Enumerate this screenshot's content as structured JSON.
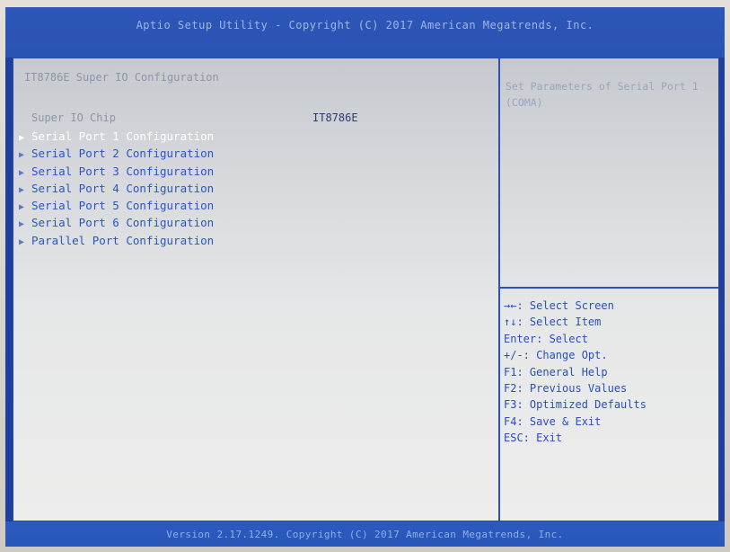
{
  "header": {
    "title": "Aptio Setup Utility - Copyright (C) 2017 American Megatrends, Inc."
  },
  "main": {
    "section_title": "IT8786E Super IO Configuration",
    "super_io_chip": {
      "label": "Super IO Chip",
      "value": "IT8786E"
    },
    "menu_items": [
      {
        "label": "Serial Port 1 Configuration",
        "selected": true
      },
      {
        "label": "Serial Port 2 Configuration",
        "selected": false
      },
      {
        "label": "Serial Port 3 Configuration",
        "selected": false
      },
      {
        "label": "Serial Port 4 Configuration",
        "selected": false
      },
      {
        "label": "Serial Port 5 Configuration",
        "selected": false
      },
      {
        "label": "Serial Port 6 Configuration",
        "selected": false
      },
      {
        "label": "Parallel Port Configuration",
        "selected": false
      }
    ],
    "submenu_arrow": "▶"
  },
  "help": {
    "item_help": "Set Parameters of Serial Port 1 (COMA)",
    "keys": [
      "→←: Select Screen",
      "↑↓: Select Item",
      "Enter: Select",
      "+/-: Change Opt.",
      "F1: General Help",
      "F2: Previous Values",
      "F3: Optimized Defaults",
      "F4: Save & Exit",
      "ESC: Exit"
    ]
  },
  "footer": {
    "text": "Version 2.17.1249. Copyright (C) 2017 American Megatrends, Inc."
  },
  "colors": {
    "background_blue": "#1e3f9c",
    "panel_gray": "#e6e7e8",
    "item_blue": "#2b55c4",
    "selected_white": "#ffffff",
    "dim_gray": "#8e95a6"
  }
}
